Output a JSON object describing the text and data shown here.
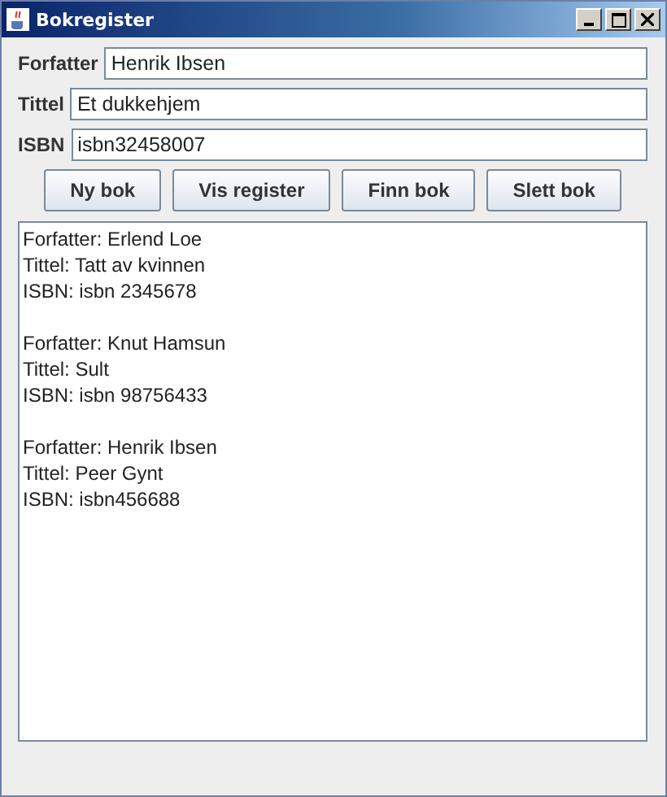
{
  "window": {
    "title": "Bokregister"
  },
  "fields": [
    {
      "label": "Forfatter",
      "value": "Henrik Ibsen"
    },
    {
      "label": "Tittel",
      "value": "Et dukkehjem"
    },
    {
      "label": "ISBN",
      "value": "isbn32458007"
    }
  ],
  "buttons": [
    "Ny bok",
    "Vis register",
    "Finn bok",
    "Slett bok"
  ],
  "output": [
    {
      "lines": [
        "Forfatter: Erlend Loe",
        "Tittel: Tatt av kvinnen",
        "ISBN: isbn 2345678"
      ]
    },
    {
      "lines": [
        "Forfatter: Knut Hamsun",
        "Tittel: Sult",
        "ISBN: isbn 98756433"
      ]
    },
    {
      "lines": [
        "Forfatter: Henrik Ibsen",
        "Tittel: Peer Gynt",
        "ISBN: isbn456688"
      ]
    }
  ]
}
